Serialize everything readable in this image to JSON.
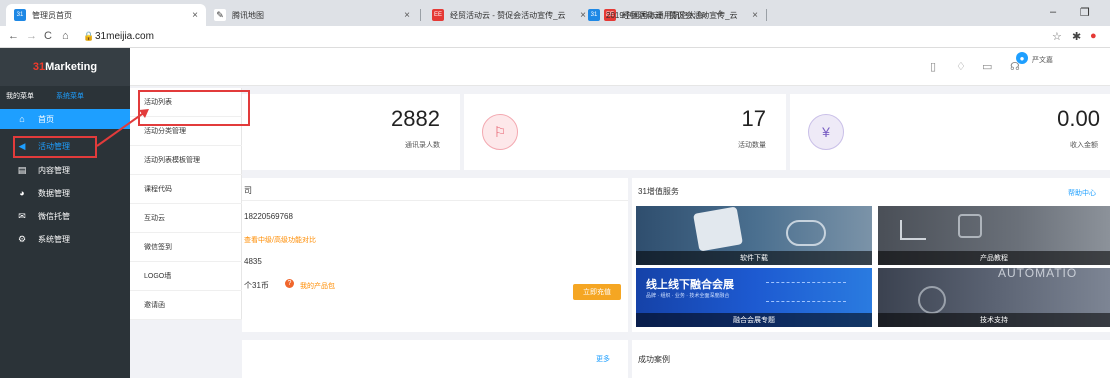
{
  "browser": {
    "tabs": [
      {
        "title": "管理员首页",
        "favicon": "31",
        "color": "#1e88e5"
      },
      {
        "title": "腾讯地图",
        "favicon": "✎",
        "color": "#333333"
      },
      {
        "title": "经贸活动云 - 赞促会活动宣传_云",
        "favicon": "EE",
        "color": "#e53935"
      },
      {
        "title": "经贸活动云 - 赞促会活动宣传_云",
        "favicon": "EE",
        "color": "#e53935"
      },
      {
        "title": "2019中国国际通用航空大会",
        "favicon": "31",
        "color": "#1e88e5"
      }
    ],
    "close_glyph": "×",
    "newtab_glyph": "+",
    "url": "31meijia.com",
    "window_controls": [
      "–",
      "❐"
    ]
  },
  "app": {
    "logo_prefix": "31",
    "logo_text": "Marketing",
    "menu_tab_mine": "我的菜单",
    "menu_tab_system": "系统菜单",
    "menu": [
      {
        "label": "首页",
        "icon": "home-icon",
        "glyph": "⌂"
      },
      {
        "label": "活动管理",
        "icon": "megaphone-icon",
        "glyph": "◀"
      },
      {
        "label": "内容管理",
        "icon": "document-icon",
        "glyph": "▤"
      },
      {
        "label": "数据管理",
        "icon": "pie-chart-icon",
        "glyph": "◕"
      },
      {
        "label": "微信托管",
        "icon": "wechat-icon",
        "glyph": "✉"
      },
      {
        "label": "系统管理",
        "icon": "gear-icon",
        "glyph": "⚙"
      }
    ],
    "submenu": [
      "活动列表",
      "活动分类管理",
      "活动列表模板管理",
      "课程代码",
      "互动云",
      "微信签到",
      "LOGO墙",
      "邀请函"
    ]
  },
  "header": {
    "icons": [
      "document-icon",
      "bell-icon",
      "chat-icon",
      "headset-icon"
    ],
    "user_name": "严文嘉"
  },
  "stats": [
    {
      "value": "2882",
      "label": "通讯录人数",
      "icon": "flag-icon",
      "glyph": "⚐"
    },
    {
      "value": "17",
      "label": "活动数量",
      "icon": "flag-icon",
      "glyph": "⚐"
    },
    {
      "value": "0.00",
      "label": "收入金额",
      "icon": "yen-icon",
      "glyph": "¥"
    }
  ],
  "company_panel": {
    "title_fragment": "司",
    "phone": "18220569768",
    "compare_link": "查看中级/高级功能对比",
    "code_fragment": "4835",
    "coins_text": "个31币",
    "product_link": "我的产品包",
    "recharge_button": "立即充值"
  },
  "service_panel": {
    "title": "31增值服务",
    "help_link": "帮助中心",
    "tiles": [
      {
        "caption": "软件下载"
      },
      {
        "caption": "产品教程"
      },
      {
        "caption": "融合会展专题",
        "headline": "线上线下融合会展",
        "subline": "品牌 · 组织 · 业务 · 技术全面深度融合"
      },
      {
        "caption": "技术支持",
        "overlay": "AUTOMATIO"
      }
    ]
  },
  "bottom": {
    "more_link": "更多",
    "cases_title": "成功案例"
  }
}
